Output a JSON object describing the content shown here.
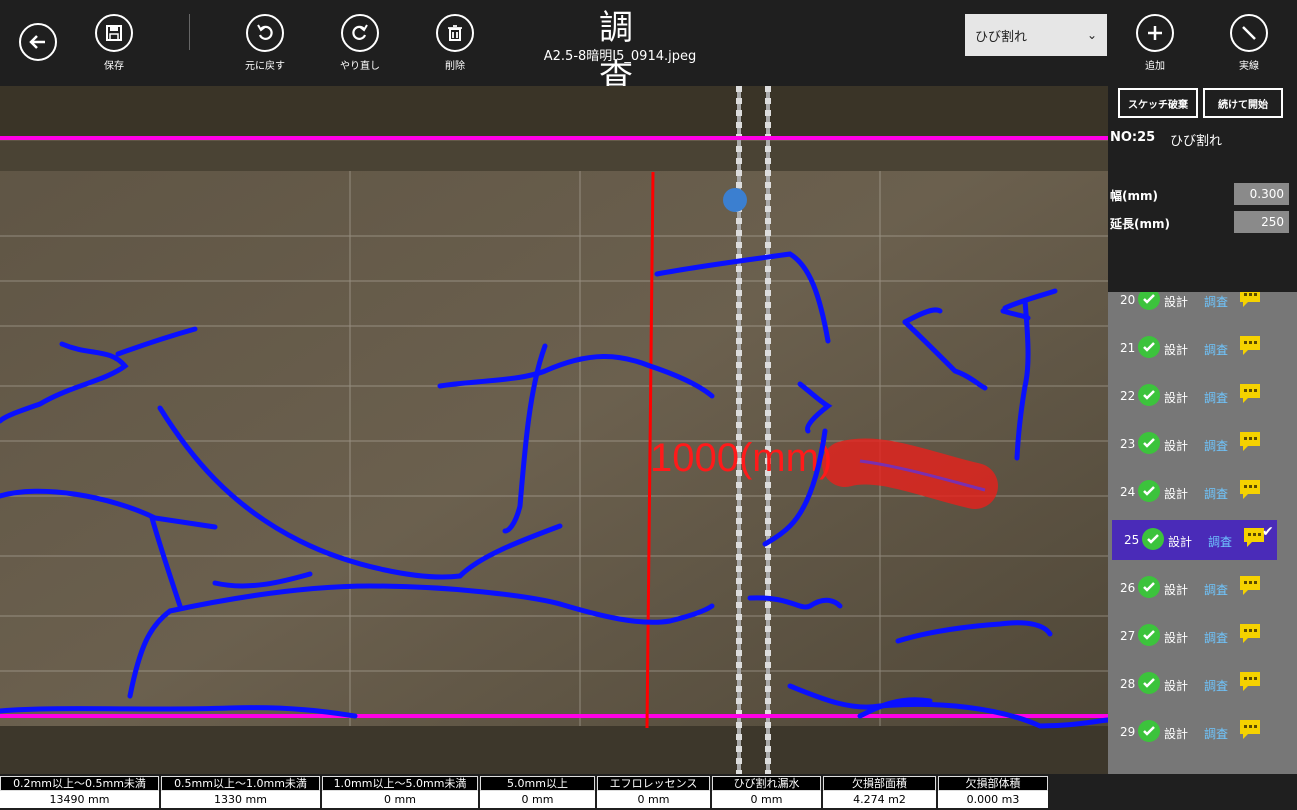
{
  "header": {
    "title": "調　査",
    "filename": "A2.5-8暗明I5_0914.jpeg",
    "buttons": {
      "save": "保存",
      "undo": "元に戻す",
      "redo": "やり直し",
      "delete": "削除",
      "add": "追加",
      "line": "実線"
    },
    "type_select": "ひび割れ"
  },
  "photo": {
    "annotation": "1000(mm)",
    "colors": {
      "guide_line": "#ff00e6",
      "measure_line": "#ff0000",
      "crack": "#0a10ff",
      "highlight": "#e8201c"
    }
  },
  "sidebar": {
    "discard_button": "スケッチ破棄",
    "continue_button": "続けて開始",
    "no_label": "NO:25",
    "type_label": "ひび割れ",
    "width_label": "幅(mm)",
    "width_value": "0.300",
    "length_label": "延長(mm)",
    "length_value": "250",
    "items": [
      {
        "no": "20",
        "design": "設計",
        "survey": "調査"
      },
      {
        "no": "21",
        "design": "設計",
        "survey": "調査"
      },
      {
        "no": "22",
        "design": "設計",
        "survey": "調査"
      },
      {
        "no": "23",
        "design": "設計",
        "survey": "調査"
      },
      {
        "no": "24",
        "design": "設計",
        "survey": "調査"
      },
      {
        "no": "25",
        "design": "設計",
        "survey": "調査"
      },
      {
        "no": "26",
        "design": "設計",
        "survey": "調査"
      },
      {
        "no": "27",
        "design": "設計",
        "survey": "調査"
      },
      {
        "no": "28",
        "design": "設計",
        "survey": "調査"
      },
      {
        "no": "29",
        "design": "設計",
        "survey": "調査"
      }
    ],
    "selected_no": "25"
  },
  "stats": [
    {
      "label": "0.2mm以上～0.5mm未満",
      "value": "13490 mm"
    },
    {
      "label": "0.5mm以上～1.0mm未満",
      "value": "1330 mm"
    },
    {
      "label": "1.0mm以上～5.0mm未満",
      "value": "0 mm"
    },
    {
      "label": "5.0mm以上",
      "value": "0 mm"
    },
    {
      "label": "エフロレッセンス",
      "value": "0 mm"
    },
    {
      "label": "ひび割れ漏水",
      "value": "0 mm"
    },
    {
      "label": "欠損部面積",
      "value": "4.274 m2"
    },
    {
      "label": "欠損部体積",
      "value": "0.000 m3"
    }
  ]
}
